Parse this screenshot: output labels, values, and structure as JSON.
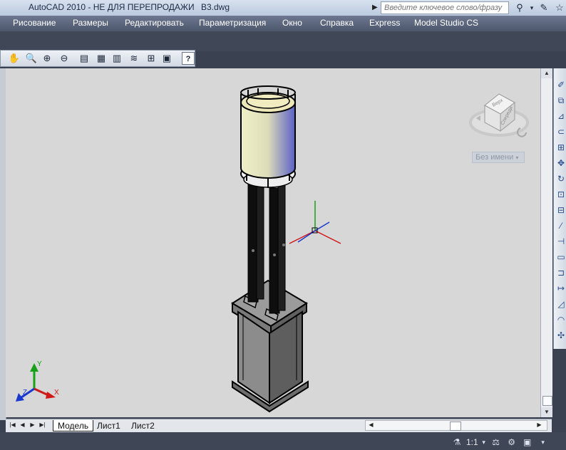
{
  "title": {
    "app": "AutoCAD 2010 - НЕ ДЛЯ ПЕРЕПРОДАЖИ",
    "file": "B3.dwg"
  },
  "search": {
    "placeholder": "Введите ключевое слово/фразу"
  },
  "menu": [
    "Рисование",
    "Размеры",
    "Редактировать",
    "Параметризация",
    "Окно",
    "Справка",
    "Express",
    "Model Studio CS"
  ],
  "viewcube": {
    "top_label": "Верх",
    "front_label": "Спереди",
    "named_view": "Без имени"
  },
  "ucs": {
    "x_label": "X",
    "y_label": "Y",
    "z_label": "Z"
  },
  "tabs": [
    "Модель",
    "Лист1",
    "Лист2"
  ],
  "status": {
    "scale": "1:1"
  },
  "icons": {
    "zoom_toolbar": [
      "pan-icon",
      "zoom-realtime-icon",
      "zoom-window-icon",
      "zoom-previous-icon",
      "properties-icon",
      "design-center-icon",
      "tool-palettes-icon",
      "sheet-set-icon",
      "markup-icon",
      "quickcalc-icon",
      "help-icon"
    ],
    "right_toolbar": [
      "erase-icon",
      "copy-icon",
      "mirror-icon",
      "offset-icon",
      "array-icon",
      "move-icon",
      "rotate-icon",
      "scale-icon",
      "stretch-icon",
      "trim-icon",
      "extend-icon",
      "break-icon",
      "join-icon",
      "chamfer-icon",
      "fillet-icon",
      "explode-icon"
    ]
  },
  "colors": {
    "viewport_bg": "#d7d7d7",
    "menubar": "#5a6479",
    "axis_x": "#d01818",
    "axis_y": "#18a018",
    "axis_z": "#1838d0"
  }
}
